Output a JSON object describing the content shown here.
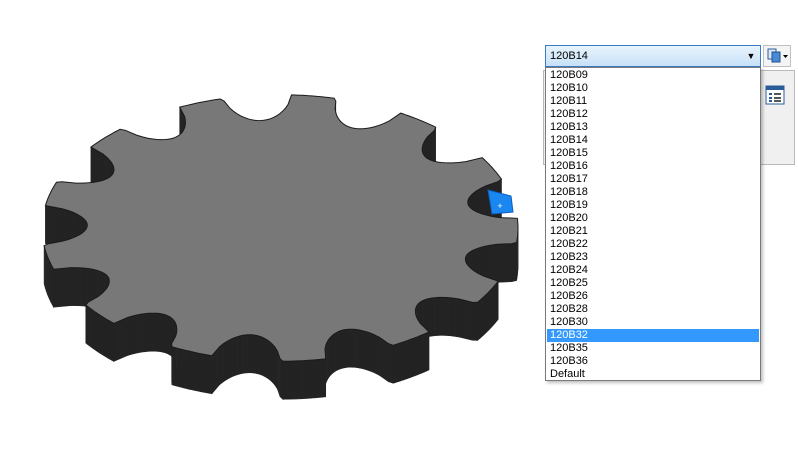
{
  "model_viewport": {
    "face_color": "#787878",
    "side_color": "#404040",
    "highlight_color": "#1a86f0",
    "cursor_glyph": "+"
  },
  "part_selector": {
    "current_value": "120B14",
    "options": [
      "120B09",
      "120B10",
      "120B11",
      "120B12",
      "120B13",
      "120B14",
      "120B15",
      "120B16",
      "120B17",
      "120B18",
      "120B19",
      "120B20",
      "120B21",
      "120B22",
      "120B23",
      "120B24",
      "120B25",
      "120B26",
      "120B28",
      "120B30",
      "120B32",
      "120B35",
      "120B36",
      "Default"
    ],
    "highlighted_option": "120B32",
    "side_button_icon": "configuration-icon"
  },
  "background_panel": {
    "icon": "property-list-icon"
  }
}
